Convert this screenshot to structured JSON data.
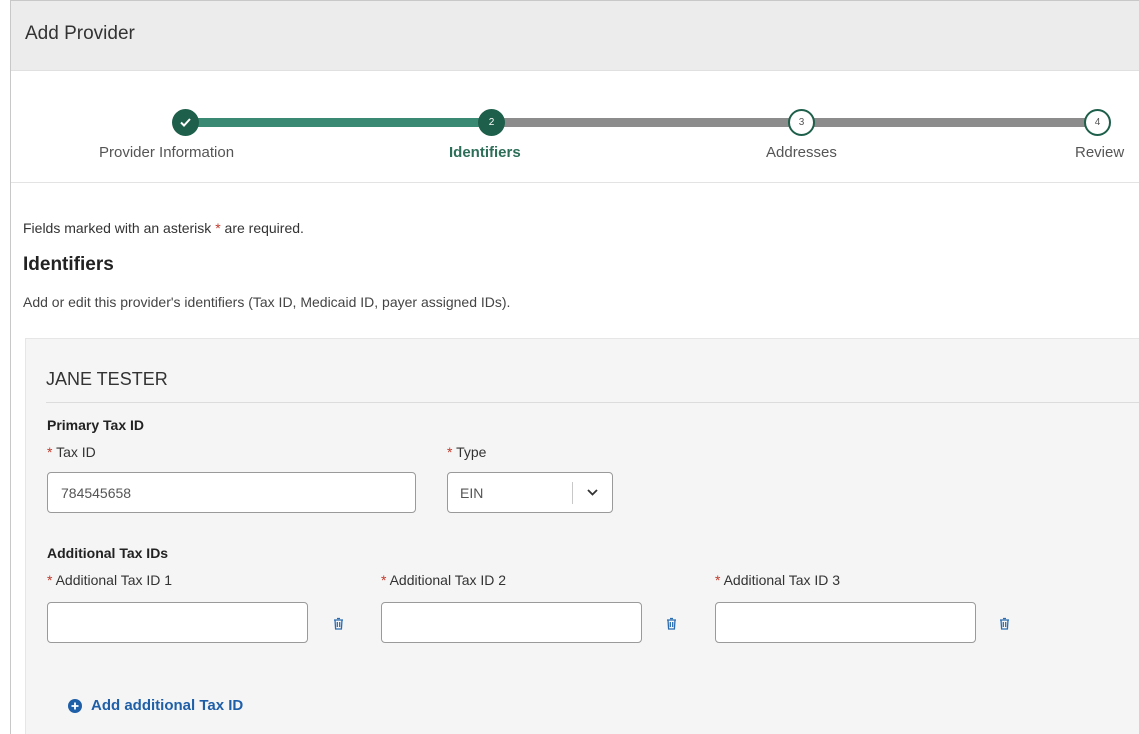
{
  "header": {
    "title": "Add Provider"
  },
  "stepper": {
    "steps": [
      {
        "number": "1",
        "label": "Provider Information",
        "state": "complete"
      },
      {
        "number": "2",
        "label": "Identifiers",
        "state": "active"
      },
      {
        "number": "3",
        "label": "Addresses",
        "state": "pending"
      },
      {
        "number": "4",
        "label": "Review",
        "state": "pending"
      }
    ],
    "colors": {
      "complete": "#3a8a73",
      "pending": "#8c8c8c",
      "circle": "#1d5f4a"
    }
  },
  "form": {
    "required_note_prefix": "Fields marked with an asterisk",
    "required_note_suffix": "are required.",
    "asterisk": "*",
    "section_title": "Identifiers",
    "section_description": "Add or edit this provider's identifiers (Tax ID, Medicaid ID, payer assigned IDs)."
  },
  "provider": {
    "name": "JANE TESTER",
    "primary_tax": {
      "heading": "Primary Tax ID",
      "tax_id_label": "Tax ID",
      "tax_id_value": "784545658",
      "type_label": "Type",
      "type_value": "EIN"
    },
    "additional_tax": {
      "heading": "Additional Tax IDs",
      "fields": [
        {
          "label": "Additional Tax ID 1",
          "value": ""
        },
        {
          "label": "Additional Tax ID 2",
          "value": ""
        },
        {
          "label": "Additional Tax ID 3",
          "value": ""
        }
      ],
      "add_link_label": "Add additional Tax ID"
    }
  },
  "icons": {
    "check": "check-icon",
    "chevron": "chevron-down-icon",
    "trash": "trash-icon",
    "plus": "plus-circle-icon"
  },
  "accent_color": "#1f5fa8"
}
